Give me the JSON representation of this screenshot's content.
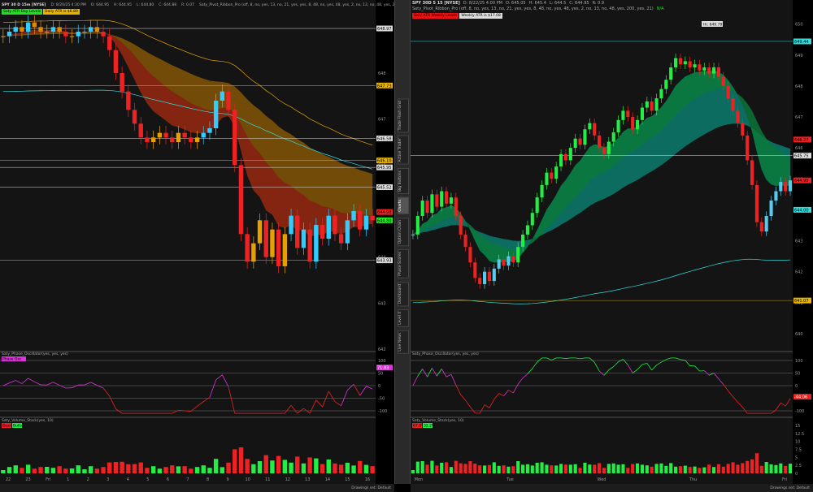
{
  "left": {
    "header": {
      "symbol": "SPY 30 D 15m [NYSE]",
      "date": "D: 8/20/25 4:30 PM",
      "open": "O: 644.95",
      "high": "H: 644.95",
      "low": "L: 644.80",
      "close": "C: 644.88",
      "range": "R: 0.07",
      "study": "Saty_Pivot_Ribbon_Pro (off, 8, no, yes, 13, no, 21, yes, yes, 8, 48, no, yes, 48, yes, 2, no, 13, no, 48, yes, 200, yes, 21)",
      "na": "N/A"
    },
    "tags": [
      {
        "text": "Saty ATR Day Levels",
        "color": "#22dd22"
      },
      {
        "text": "Daily ATR is $6.89",
        "color": "#e8b400"
      }
    ],
    "osc_label": "Saty_Phase_Oscillator(yes, yes, yes)",
    "osc_badge": "Phase Osc",
    "vol_label": "Saty_Volume_Stack(yes, 10)",
    "vol_tags": [
      "Bears",
      "Bulls"
    ],
    "time_ticks": [
      "22",
      "23",
      "Fri",
      "1",
      "2",
      "3",
      "4",
      "5",
      "6",
      "7",
      "8",
      "9",
      "10",
      "11",
      "12",
      "13",
      "14",
      "15",
      "16"
    ],
    "drawing_set": "Drawings set: Default"
  },
  "right": {
    "header": {
      "symbol": "SPY 30D 5 15 [NYSE]",
      "date": "D: 8/22/25 4:00 PM",
      "open": "O: 645.05",
      "high": "H: 645.4",
      "low": "L: 644.5",
      "close": "C: 644.95",
      "range": "R: 0.9",
      "study": "Saty_Pivot_Ribbon_Pro (off, 8, no, yes, 13, no, 21, yes, yes, 8, 48, no, yes, 48, yes, 2, no, 13, no, 48, yes, 200, yes, 21)",
      "na": "N/A"
    },
    "tags": [
      {
        "text": "Saty ATR Weekly Levels",
        "color": "#ee1111"
      },
      {
        "text": "Weekly ATR is $17.08",
        "color": "#dddddd"
      }
    ],
    "hi_label": "Hi: 649.79",
    "osc_label": "Saty_Phase_Oscillator(yes, yes, yes)",
    "vol_label": "Saty_Volume_Stack(yes, 10)",
    "vol_tags": [
      "67.8%",
      "32.2%"
    ],
    "time_ticks": [
      "Mon",
      "Tue",
      "Wed",
      "Thu",
      "Fri"
    ],
    "drawing_set": "Drawings set: Default"
  },
  "side_tabs": [
    "Live News",
    "Level II",
    "Dashboard",
    "Phase Scores",
    "Option Chain",
    "Charts",
    "Big Buttons",
    "Active Trader",
    "Trade Flash Grid"
  ],
  "active_tab": "Charts",
  "colors": {
    "bull": "#22ee44",
    "bear": "#ee2222",
    "cyan": "#33dddd",
    "orange": "#e8a000",
    "ribbon_up": "#0a8a5a",
    "ribbon_down": "#8a1010",
    "osc": "#dd33dd"
  },
  "chart_data": [
    {
      "type": "candlestick",
      "panel": "left",
      "timeframe": "15m",
      "ylim": [
        642,
        649.2
      ],
      "yticks": [
        642,
        643,
        644,
        645,
        646,
        647,
        648,
        649
      ],
      "levels": [
        {
          "value": 648.97,
          "label": "648.97",
          "color": "#dddddd"
        },
        {
          "value": 647.73,
          "label": "647.73",
          "color": "#e8b400"
        },
        {
          "value": 646.58,
          "label": "646.58",
          "color": "#dddddd"
        },
        {
          "value": 646.1,
          "label": "646.10",
          "color": "#e8b400"
        },
        {
          "value": 645.95,
          "label": "645.95",
          "color": "#dddddd"
        },
        {
          "value": 645.52,
          "label": "645.52",
          "color": "#dddddd"
        },
        {
          "value": 643.93,
          "label": "643.93",
          "color": "#dddddd"
        }
      ],
      "last_labels": [
        {
          "value": 644.98,
          "label": "644.98",
          "color": "#ee2222"
        },
        {
          "value": 644.8,
          "label": "644.80",
          "color": "#22ee22"
        }
      ],
      "close": [
        648.8,
        648.9,
        649.0,
        648.9,
        649.1,
        649.0,
        648.9,
        648.9,
        649.0,
        648.9,
        648.8,
        648.8,
        648.9,
        648.9,
        649.0,
        648.9,
        648.8,
        648.5,
        648.0,
        647.6,
        647.2,
        646.9,
        646.6,
        646.5,
        646.6,
        646.7,
        646.6,
        646.5,
        646.7,
        646.6,
        646.5,
        646.6,
        646.7,
        646.8,
        647.4,
        647.6,
        647.2,
        646.0,
        644.5,
        643.9,
        644.3,
        644.8,
        644.0,
        644.6,
        643.8,
        644.5,
        644.9,
        644.2,
        644.6,
        643.9,
        644.7,
        644.4,
        644.9,
        644.5,
        644.3,
        644.8,
        645.0,
        644.6,
        644.9,
        644.8
      ],
      "osc_yticks": [
        100,
        50,
        0,
        -50,
        -100
      ],
      "osc_last": "71.83"
    },
    {
      "type": "candlestick",
      "panel": "right",
      "timeframe": "15m",
      "ylim": [
        639.5,
        650.2
      ],
      "yticks": [
        640,
        641,
        642,
        643,
        644,
        645,
        646,
        647,
        648,
        649,
        650
      ],
      "levels": [
        {
          "value": 649.44,
          "label": "649.44",
          "color": "#33dddd"
        },
        {
          "value": 645.75,
          "label": "645.75",
          "color": "#dddddd"
        },
        {
          "value": 641.07,
          "label": "641.07",
          "color": "#e8b400"
        }
      ],
      "last_labels": [
        {
          "value": 646.27,
          "label": "646.27",
          "color": "#ee2222"
        },
        {
          "value": 644.95,
          "label": "644.95",
          "color": "#ee2222"
        },
        {
          "value": 644.0,
          "label": "644.00",
          "color": "#33dddd"
        }
      ],
      "close": [
        643.2,
        643.8,
        644.3,
        643.9,
        644.5,
        644.1,
        644.6,
        644.2,
        644.4,
        643.8,
        643.2,
        642.8,
        642.3,
        641.8,
        641.6,
        642.0,
        641.7,
        642.1,
        642.4,
        642.2,
        642.5,
        642.3,
        642.8,
        643.2,
        643.5,
        643.9,
        644.4,
        644.8,
        645.2,
        645.0,
        645.4,
        645.8,
        645.6,
        646.0,
        646.3,
        646.1,
        646.6,
        646.8,
        646.4,
        646.0,
        645.8,
        646.2,
        646.5,
        646.9,
        647.2,
        647.0,
        646.6,
        646.9,
        647.3,
        647.5,
        647.2,
        647.6,
        647.9,
        648.2,
        648.6,
        648.9,
        648.7,
        648.8,
        648.6,
        648.7,
        648.5,
        648.6,
        648.4,
        648.6,
        648.3,
        648.0,
        647.6,
        647.2,
        646.8,
        646.4,
        645.6,
        644.8,
        643.6,
        643.3,
        643.8,
        644.3,
        644.6,
        644.9,
        644.6,
        644.95
      ],
      "osc_yticks": [
        100,
        50,
        0,
        -100
      ],
      "osc_last": "-44.06",
      "vol_yticks": [
        0,
        2.5,
        5,
        7.5,
        10,
        12.5,
        15
      ],
      "vol_unit": "millions"
    }
  ]
}
